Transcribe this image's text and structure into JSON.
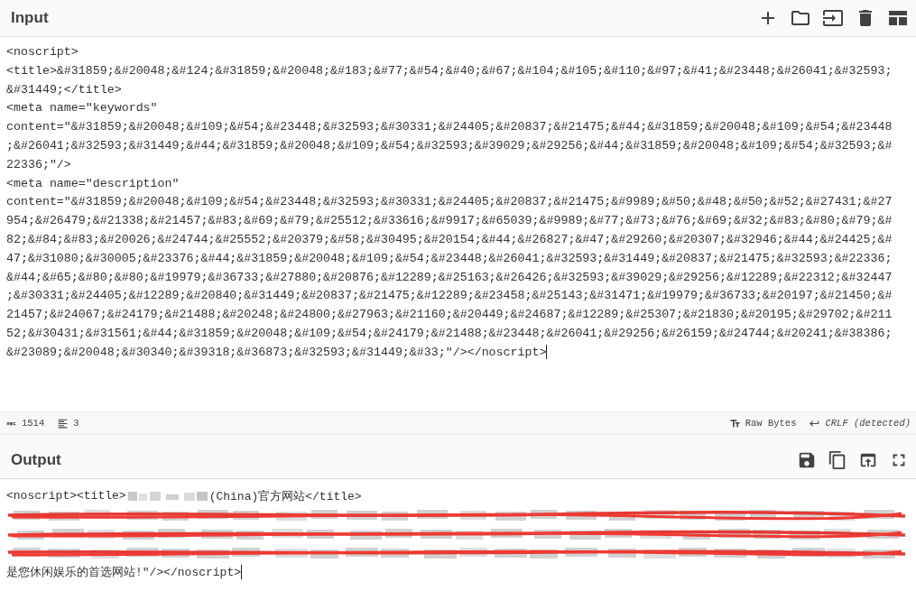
{
  "input": {
    "title": "Input",
    "lines": [
      "<noscript>",
      "<title>&#31859;&#20048;&#124;&#31859;&#20048;&#183;&#77;&#54;&#40;&#67;&#104;&#105;&#110;&#97;&#41;&#23448;&#26041;&#32593;",
      "&#31449;</title>",
      "<meta name=\"keywords\"",
      "content=\"&#31859;&#20048;&#109;&#54;&#23448;&#32593;&#30331;&#24405;&#20837;&#21475;&#44;&#31859;&#20048;&#109;&#54;&#23448",
      ";&#26041;&#32593;&#31449;&#44;&#31859;&#20048;&#109;&#54;&#32593;&#39029;&#29256;&#44;&#31859;&#20048;&#109;&#54;&#32593;&#",
      "22336;\"/>",
      "<meta name=\"description\"",
      "content=\"&#31859;&#20048;&#109;&#54;&#23448;&#32593;&#30331;&#24405;&#20837;&#21475;&#9989;&#50;&#48;&#50;&#52;&#27431;&#27",
      "954;&#26479;&#21338;&#21457;&#83;&#69;&#79;&#25512;&#33616;&#9917;&#65039;&#9989;&#77;&#73;&#76;&#69;&#32;&#83;&#80;&#79;&#",
      "82;&#84;&#83;&#20026;&#24744;&#25552;&#20379;&#58;&#30495;&#20154;&#44;&#26827;&#47;&#29260;&#20307;&#32946;&#44;&#24425;&#",
      "47;&#31080;&#30005;&#23376;&#44;&#31859;&#20048;&#109;&#54;&#23448;&#26041;&#32593;&#31449;&#20837;&#21475;&#32593;&#22336;",
      "&#44;&#65;&#80;&#80;&#19979;&#36733;&#27880;&#20876;&#12289;&#25163;&#26426;&#32593;&#39029;&#29256;&#12289;&#22312;&#32447",
      ";&#30331;&#24405;&#12289;&#20840;&#31449;&#20837;&#21475;&#12289;&#23458;&#25143;&#31471;&#19979;&#36733;&#20197;&#21450;&#",
      "21457;&#24067;&#24179;&#21488;&#20248;&#24800;&#27963;&#21160;&#20449;&#24687;&#12289;&#25307;&#21830;&#20195;&#29702;&#211",
      "52;&#30431;&#31561;&#44;&#31859;&#20048;&#109;&#54;&#24179;&#21488;&#23448;&#26041;&#29256;&#26159;&#24744;&#20241;&#38386;",
      "&#23089;&#20048;&#30340;&#39318;&#36873;&#32593;&#31449;&#33;\"/></noscript>"
    ]
  },
  "status_bar": {
    "length": "1514",
    "lines": "3",
    "encoding": "Raw Bytes",
    "eol": "CRLF (detected)"
  },
  "output": {
    "title": "Output",
    "lines": [
      {
        "kind": "text",
        "parts": [
          {
            "kind": "text",
            "text": "<noscript><title>"
          },
          {
            "kind": "blurred"
          },
          {
            "kind": "text",
            "text": "(China)官方网站</title>"
          }
        ]
      },
      {
        "kind": "redacted"
      },
      {
        "kind": "redacted"
      },
      {
        "kind": "redacted"
      },
      {
        "kind": "text",
        "parts": [
          {
            "kind": "text",
            "text": "是您休闲娱乐的首选网站!\"/></noscript>"
          }
        ]
      }
    ]
  }
}
